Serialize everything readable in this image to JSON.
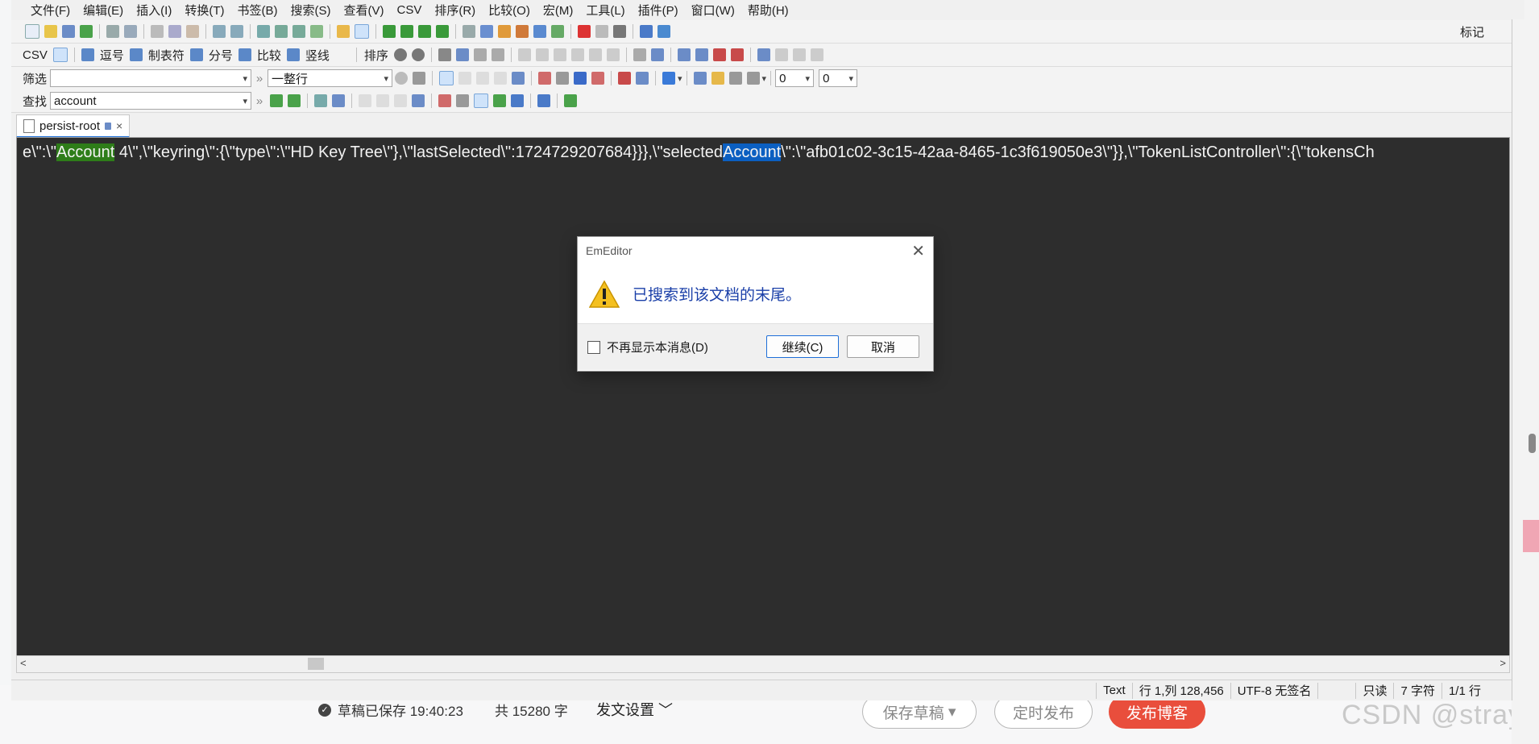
{
  "background": {
    "draft_status": "草稿已保存 19:40:23",
    "word_count": "共 15280 字",
    "publish_settings": "发文设置",
    "save_draft": "保存草稿",
    "schedule": "定时发布",
    "publish": "发布博客",
    "watermark": "CSDN @stray"
  },
  "menubar": {
    "items": [
      "文件(F)",
      "编辑(E)",
      "插入(I)",
      "转换(T)",
      "书签(B)",
      "搜索(S)",
      "查看(V)",
      "CSV",
      "排序(R)",
      "比较(O)",
      "宏(M)",
      "工具(L)",
      "插件(P)",
      "窗口(W)",
      "帮助(H)"
    ]
  },
  "toolbar1": {
    "marker_label": "标记"
  },
  "csvbar": {
    "csv_label": "CSV",
    "comma": "逗号",
    "tab_char": "制表符",
    "semicolon": "分号",
    "compare": "比较",
    "pipe": "竖线",
    "sort": "排序"
  },
  "filterbar": {
    "label": "筛选",
    "filter_value": "",
    "mode": "一整行",
    "num1": "0",
    "num2": "0"
  },
  "findbar": {
    "label": "查找",
    "value": "account"
  },
  "tab": {
    "name": "persist-root"
  },
  "editor": {
    "pre": "e\\\":\\\"",
    "match1": "Account",
    "mid": " 4\\\",\\\"keyring\\\":{\\\"type\\\":\\\"HD Key Tree\\\"},\\\"lastSelected\\\":1724729207684}}},\\\"selected",
    "match2": "Account",
    "post": "\\\":\\\"afb01c02-3c15-42aa-8465-1c3f619050e3\\\"}},\\\"TokenListController\\\":{\\\"tokensCh"
  },
  "statusbar": {
    "type": "Text",
    "position": "行 1,列 128,456",
    "encoding": "UTF-8 无签名",
    "readonly": "只读",
    "chars": "7 字符",
    "lines": "1/1 行"
  },
  "dialog": {
    "title": "EmEditor",
    "message": "已搜索到该文档的末尾。",
    "checkbox_label": "不再显示本消息(D)",
    "continue": "继续(C)",
    "cancel": "取消"
  },
  "colors": {
    "editor_bg": "#2d2d2d",
    "match_current": "#2e7d19",
    "match_other": "#0b5fc1",
    "dialog_message": "#1a3fa8",
    "publish_button": "#e94e3c"
  }
}
